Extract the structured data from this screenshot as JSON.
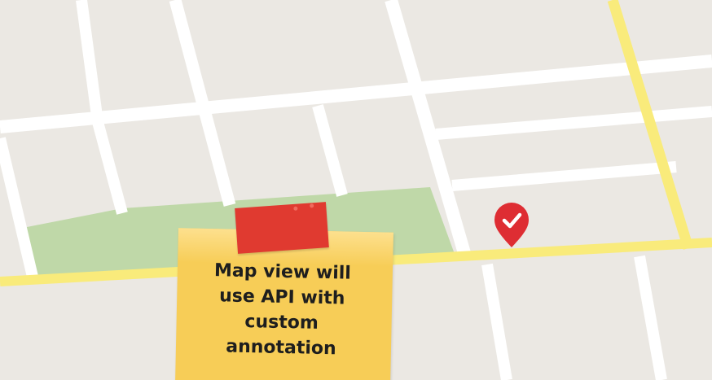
{
  "map": {
    "colors": {
      "land": "#ebe8e3",
      "street": "#ffffff",
      "highway": "#f9eb7b",
      "park": "#bfd8a8",
      "pin": "#de2d33",
      "note": "#f7cd57",
      "tape": "#e03a30"
    },
    "pin": {
      "icon": "map-pin-check-icon"
    }
  },
  "sticky_note": {
    "text": "Map view will\nuse API with\ncustom\nannotation"
  }
}
